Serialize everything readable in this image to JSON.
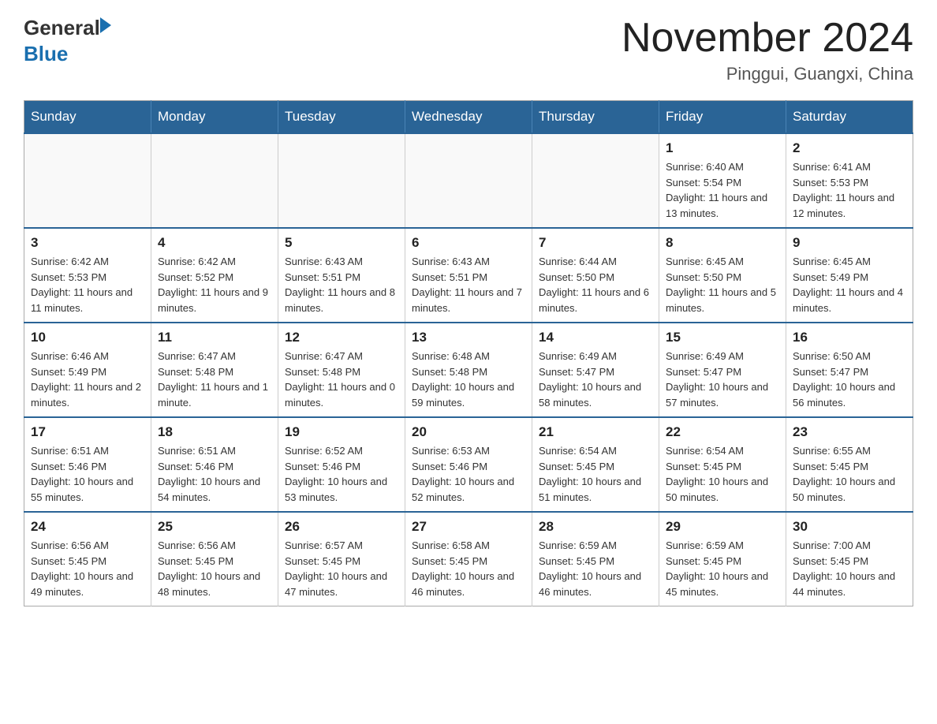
{
  "logo": {
    "general": "General",
    "blue": "Blue"
  },
  "title": "November 2024",
  "subtitle": "Pinggui, Guangxi, China",
  "weekdays": [
    "Sunday",
    "Monday",
    "Tuesday",
    "Wednesday",
    "Thursday",
    "Friday",
    "Saturday"
  ],
  "weeks": [
    [
      {
        "day": "",
        "info": ""
      },
      {
        "day": "",
        "info": ""
      },
      {
        "day": "",
        "info": ""
      },
      {
        "day": "",
        "info": ""
      },
      {
        "day": "",
        "info": ""
      },
      {
        "day": "1",
        "info": "Sunrise: 6:40 AM\nSunset: 5:54 PM\nDaylight: 11 hours and 13 minutes."
      },
      {
        "day": "2",
        "info": "Sunrise: 6:41 AM\nSunset: 5:53 PM\nDaylight: 11 hours and 12 minutes."
      }
    ],
    [
      {
        "day": "3",
        "info": "Sunrise: 6:42 AM\nSunset: 5:53 PM\nDaylight: 11 hours and 11 minutes."
      },
      {
        "day": "4",
        "info": "Sunrise: 6:42 AM\nSunset: 5:52 PM\nDaylight: 11 hours and 9 minutes."
      },
      {
        "day": "5",
        "info": "Sunrise: 6:43 AM\nSunset: 5:51 PM\nDaylight: 11 hours and 8 minutes."
      },
      {
        "day": "6",
        "info": "Sunrise: 6:43 AM\nSunset: 5:51 PM\nDaylight: 11 hours and 7 minutes."
      },
      {
        "day": "7",
        "info": "Sunrise: 6:44 AM\nSunset: 5:50 PM\nDaylight: 11 hours and 6 minutes."
      },
      {
        "day": "8",
        "info": "Sunrise: 6:45 AM\nSunset: 5:50 PM\nDaylight: 11 hours and 5 minutes."
      },
      {
        "day": "9",
        "info": "Sunrise: 6:45 AM\nSunset: 5:49 PM\nDaylight: 11 hours and 4 minutes."
      }
    ],
    [
      {
        "day": "10",
        "info": "Sunrise: 6:46 AM\nSunset: 5:49 PM\nDaylight: 11 hours and 2 minutes."
      },
      {
        "day": "11",
        "info": "Sunrise: 6:47 AM\nSunset: 5:48 PM\nDaylight: 11 hours and 1 minute."
      },
      {
        "day": "12",
        "info": "Sunrise: 6:47 AM\nSunset: 5:48 PM\nDaylight: 11 hours and 0 minutes."
      },
      {
        "day": "13",
        "info": "Sunrise: 6:48 AM\nSunset: 5:48 PM\nDaylight: 10 hours and 59 minutes."
      },
      {
        "day": "14",
        "info": "Sunrise: 6:49 AM\nSunset: 5:47 PM\nDaylight: 10 hours and 58 minutes."
      },
      {
        "day": "15",
        "info": "Sunrise: 6:49 AM\nSunset: 5:47 PM\nDaylight: 10 hours and 57 minutes."
      },
      {
        "day": "16",
        "info": "Sunrise: 6:50 AM\nSunset: 5:47 PM\nDaylight: 10 hours and 56 minutes."
      }
    ],
    [
      {
        "day": "17",
        "info": "Sunrise: 6:51 AM\nSunset: 5:46 PM\nDaylight: 10 hours and 55 minutes."
      },
      {
        "day": "18",
        "info": "Sunrise: 6:51 AM\nSunset: 5:46 PM\nDaylight: 10 hours and 54 minutes."
      },
      {
        "day": "19",
        "info": "Sunrise: 6:52 AM\nSunset: 5:46 PM\nDaylight: 10 hours and 53 minutes."
      },
      {
        "day": "20",
        "info": "Sunrise: 6:53 AM\nSunset: 5:46 PM\nDaylight: 10 hours and 52 minutes."
      },
      {
        "day": "21",
        "info": "Sunrise: 6:54 AM\nSunset: 5:45 PM\nDaylight: 10 hours and 51 minutes."
      },
      {
        "day": "22",
        "info": "Sunrise: 6:54 AM\nSunset: 5:45 PM\nDaylight: 10 hours and 50 minutes."
      },
      {
        "day": "23",
        "info": "Sunrise: 6:55 AM\nSunset: 5:45 PM\nDaylight: 10 hours and 50 minutes."
      }
    ],
    [
      {
        "day": "24",
        "info": "Sunrise: 6:56 AM\nSunset: 5:45 PM\nDaylight: 10 hours and 49 minutes."
      },
      {
        "day": "25",
        "info": "Sunrise: 6:56 AM\nSunset: 5:45 PM\nDaylight: 10 hours and 48 minutes."
      },
      {
        "day": "26",
        "info": "Sunrise: 6:57 AM\nSunset: 5:45 PM\nDaylight: 10 hours and 47 minutes."
      },
      {
        "day": "27",
        "info": "Sunrise: 6:58 AM\nSunset: 5:45 PM\nDaylight: 10 hours and 46 minutes."
      },
      {
        "day": "28",
        "info": "Sunrise: 6:59 AM\nSunset: 5:45 PM\nDaylight: 10 hours and 46 minutes."
      },
      {
        "day": "29",
        "info": "Sunrise: 6:59 AM\nSunset: 5:45 PM\nDaylight: 10 hours and 45 minutes."
      },
      {
        "day": "30",
        "info": "Sunrise: 7:00 AM\nSunset: 5:45 PM\nDaylight: 10 hours and 44 minutes."
      }
    ]
  ]
}
